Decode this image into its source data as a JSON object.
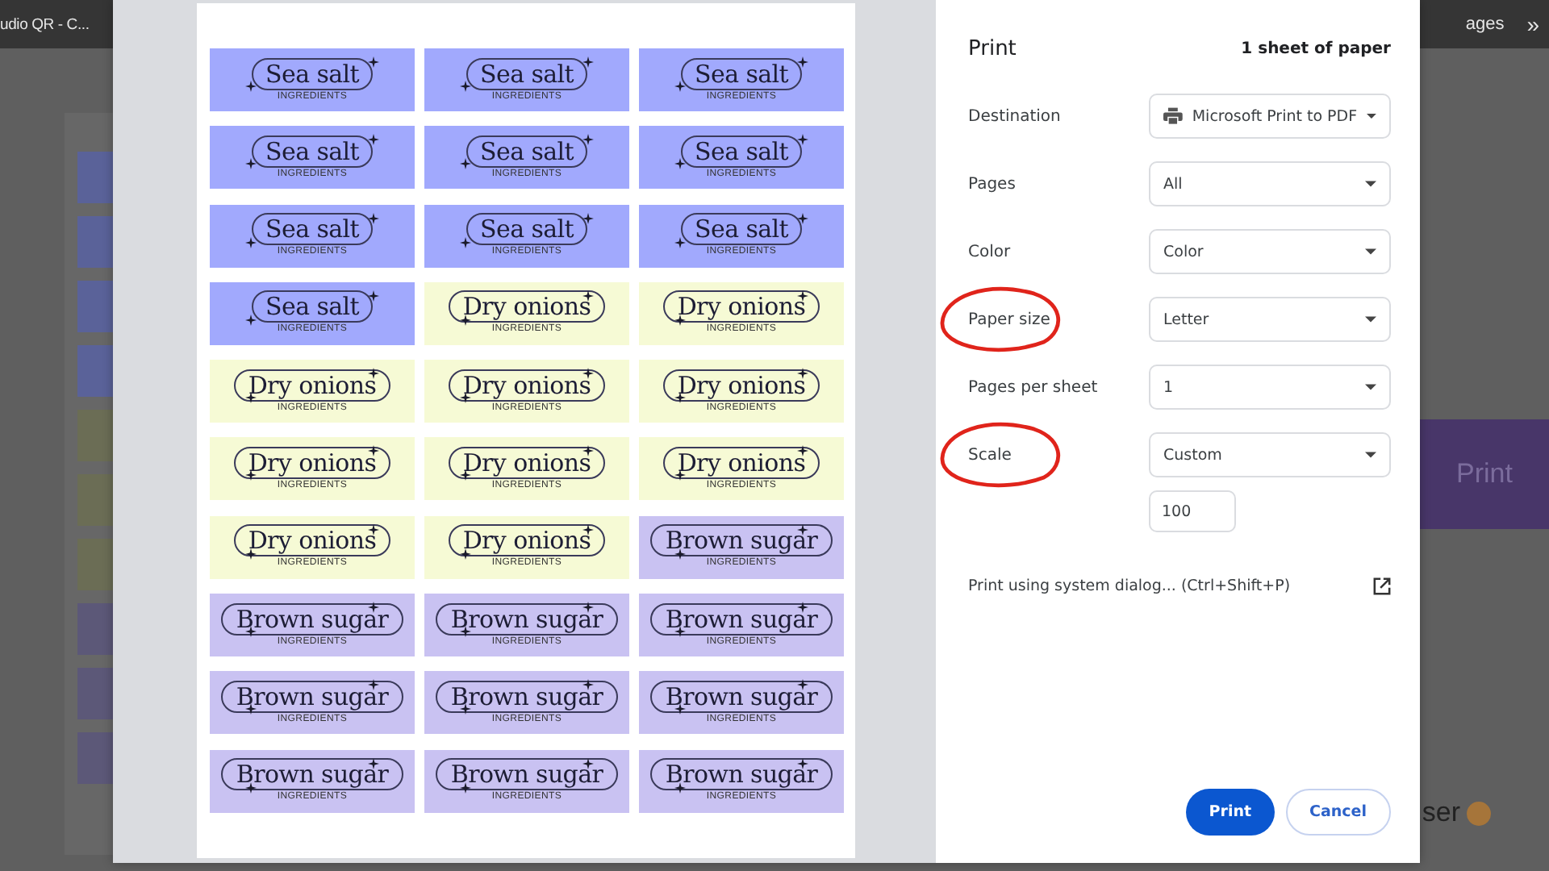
{
  "browser": {
    "tab_title": "udio QR - C...",
    "bookmark_text": "ages",
    "overflow": "»"
  },
  "background_page": {
    "strips": [
      {
        "color": "#5a6299"
      },
      {
        "color": "#5a6299"
      },
      {
        "color": "#5a6299"
      },
      {
        "color": "#5a6299"
      },
      {
        "color": "#6b6d55"
      },
      {
        "color": "#6b6d55"
      },
      {
        "color": "#6b6d55"
      },
      {
        "color": "#5c5878"
      },
      {
        "color": "#5c5878"
      },
      {
        "color": "#5c5878"
      }
    ],
    "button": "Print",
    "footer_text": "ser"
  },
  "preview": {
    "labels": [
      {
        "name": "Sea salt",
        "subtitle": "INGREDIENTS",
        "color": "#a1a9fd"
      },
      {
        "name": "Sea salt",
        "subtitle": "INGREDIENTS",
        "color": "#a1a9fd"
      },
      {
        "name": "Sea salt",
        "subtitle": "INGREDIENTS",
        "color": "#a1a9fd"
      },
      {
        "name": "Sea salt",
        "subtitle": "INGREDIENTS",
        "color": "#a1a9fd"
      },
      {
        "name": "Sea salt",
        "subtitle": "INGREDIENTS",
        "color": "#a1a9fd"
      },
      {
        "name": "Sea salt",
        "subtitle": "INGREDIENTS",
        "color": "#a1a9fd"
      },
      {
        "name": "Sea salt",
        "subtitle": "INGREDIENTS",
        "color": "#a1a9fd"
      },
      {
        "name": "Sea salt",
        "subtitle": "INGREDIENTS",
        "color": "#a1a9fd"
      },
      {
        "name": "Sea salt",
        "subtitle": "INGREDIENTS",
        "color": "#a1a9fd"
      },
      {
        "name": "Sea salt",
        "subtitle": "INGREDIENTS",
        "color": "#a1a9fd"
      },
      {
        "name": "Dry onions",
        "subtitle": "INGREDIENTS",
        "color": "#f6fad5"
      },
      {
        "name": "Dry onions",
        "subtitle": "INGREDIENTS",
        "color": "#f6fad5"
      },
      {
        "name": "Dry onions",
        "subtitle": "INGREDIENTS",
        "color": "#f6fad5"
      },
      {
        "name": "Dry onions",
        "subtitle": "INGREDIENTS",
        "color": "#f6fad5"
      },
      {
        "name": "Dry onions",
        "subtitle": "INGREDIENTS",
        "color": "#f6fad5"
      },
      {
        "name": "Dry onions",
        "subtitle": "INGREDIENTS",
        "color": "#f6fad5"
      },
      {
        "name": "Dry onions",
        "subtitle": "INGREDIENTS",
        "color": "#f6fad5"
      },
      {
        "name": "Dry onions",
        "subtitle": "INGREDIENTS",
        "color": "#f6fad5"
      },
      {
        "name": "Dry onions",
        "subtitle": "INGREDIENTS",
        "color": "#f6fad5"
      },
      {
        "name": "Dry onions",
        "subtitle": "INGREDIENTS",
        "color": "#f6fad5"
      },
      {
        "name": "Brown sugar",
        "subtitle": "INGREDIENTS",
        "color": "#c9c2f2"
      },
      {
        "name": "Brown sugar",
        "subtitle": "INGREDIENTS",
        "color": "#c9c2f2"
      },
      {
        "name": "Brown sugar",
        "subtitle": "INGREDIENTS",
        "color": "#c9c2f2"
      },
      {
        "name": "Brown sugar",
        "subtitle": "INGREDIENTS",
        "color": "#c9c2f2"
      },
      {
        "name": "Brown sugar",
        "subtitle": "INGREDIENTS",
        "color": "#c9c2f2"
      },
      {
        "name": "Brown sugar",
        "subtitle": "INGREDIENTS",
        "color": "#c9c2f2"
      },
      {
        "name": "Brown sugar",
        "subtitle": "INGREDIENTS",
        "color": "#c9c2f2"
      },
      {
        "name": "Brown sugar",
        "subtitle": "INGREDIENTS",
        "color": "#c9c2f2"
      },
      {
        "name": "Brown sugar",
        "subtitle": "INGREDIENTS",
        "color": "#c9c2f2"
      },
      {
        "name": "Brown sugar",
        "subtitle": "INGREDIENTS",
        "color": "#c9c2f2"
      }
    ]
  },
  "settings": {
    "title": "Print",
    "sheets": "1 sheet of paper",
    "rows": [
      {
        "label": "Destination",
        "value": "Microsoft Print to PDF",
        "kind": "destination",
        "annotated": false
      },
      {
        "label": "Pages",
        "value": "All",
        "kind": "select",
        "annotated": false
      },
      {
        "label": "Color",
        "value": "Color",
        "kind": "select",
        "annotated": false
      },
      {
        "label": "Paper size",
        "value": "Letter",
        "kind": "select",
        "annotated": true
      },
      {
        "label": "Pages per sheet",
        "value": "1",
        "kind": "select",
        "annotated": false
      },
      {
        "label": "Scale",
        "value": "Custom",
        "kind": "select",
        "annotated": true,
        "custom_value": "100"
      }
    ],
    "system_dialog": "Print using system dialog... (Ctrl+Shift+P)",
    "buttons": [
      {
        "label": "Print",
        "kind": "primary"
      },
      {
        "label": "Cancel",
        "kind": "secondary"
      }
    ]
  }
}
